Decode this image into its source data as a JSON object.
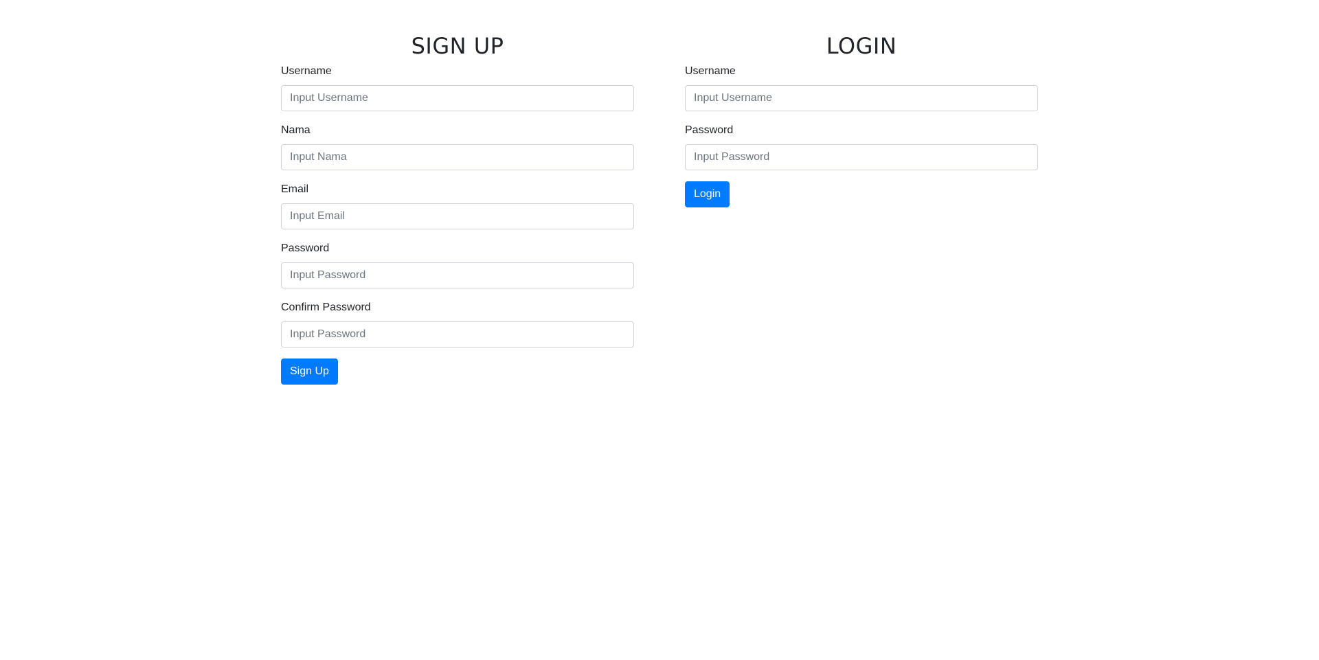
{
  "signup": {
    "title": "SIGN UP",
    "fields": [
      {
        "label": "Username",
        "placeholder": "Input Username",
        "value": ""
      },
      {
        "label": "Nama",
        "placeholder": "Input Nama",
        "value": ""
      },
      {
        "label": "Email",
        "placeholder": "Input Email",
        "value": ""
      },
      {
        "label": "Password",
        "placeholder": "Input Password",
        "value": ""
      },
      {
        "label": "Confirm Password",
        "placeholder": "Input Password",
        "value": ""
      }
    ],
    "submit_label": "Sign Up"
  },
  "login": {
    "title": "LOGIN",
    "fields": [
      {
        "label": "Username",
        "placeholder": "Input Username",
        "value": ""
      },
      {
        "label": "Password",
        "placeholder": "Input Password",
        "value": ""
      }
    ],
    "submit_label": "Login"
  },
  "colors": {
    "primary": "#007bff",
    "text": "#212529",
    "placeholder": "#6c757d",
    "input_border": "#ced4da"
  }
}
